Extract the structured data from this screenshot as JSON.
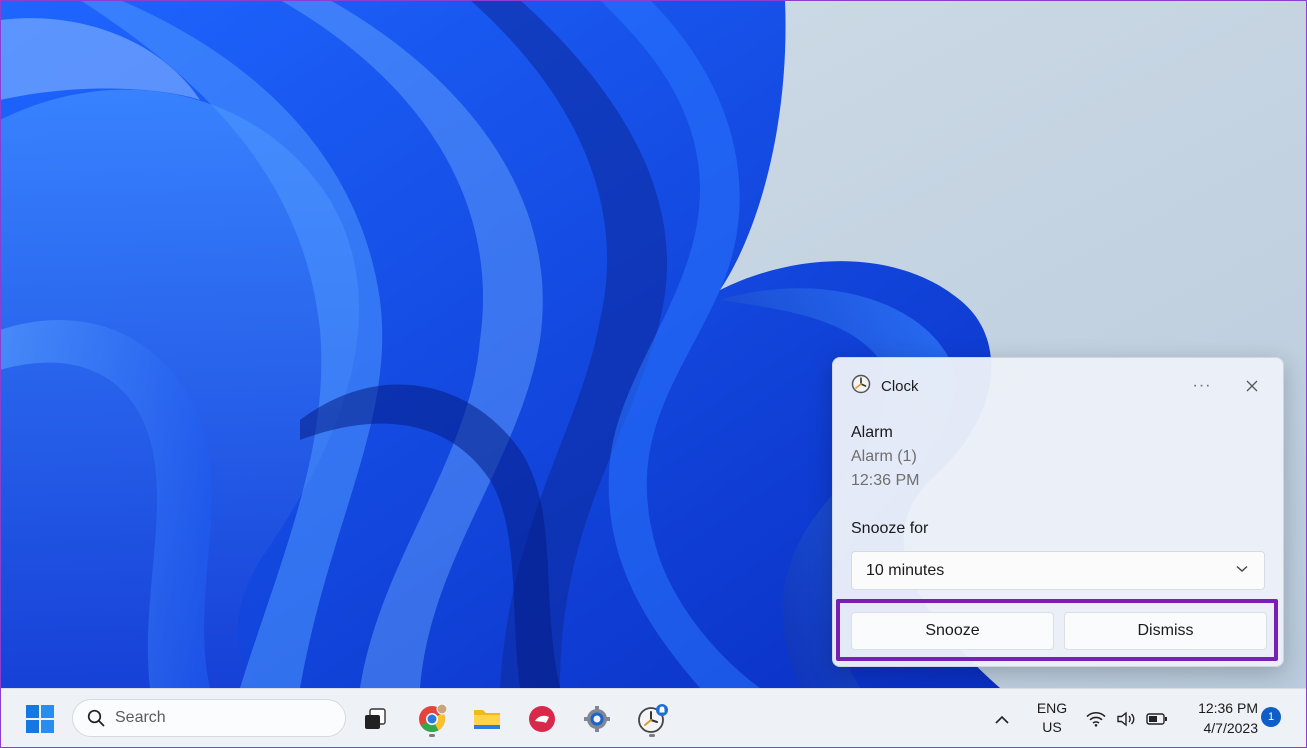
{
  "notification": {
    "app_name": "Clock",
    "more_icon": "more-dots-icon",
    "close_icon": "close-icon",
    "title": "Alarm",
    "alarm_name": "Alarm (1)",
    "time": "12:36 PM",
    "snooze_label": "Snooze for",
    "snooze_selected": "10 minutes",
    "snooze_button": "Snooze",
    "dismiss_button": "Dismiss",
    "highlight_color": "#7a1fb3"
  },
  "taskbar": {
    "search_placeholder": "Search",
    "language_line1": "ENG",
    "language_line2": "US",
    "time": "12:36 PM",
    "date": "4/7/2023",
    "notification_count": "1",
    "pinned_icons": [
      "windows-start-icon",
      "task-view-icon",
      "chrome-icon",
      "file-explorer-icon",
      "red-app-icon",
      "settings-gear-icon",
      "clock-app-icon"
    ],
    "tray_icons": [
      "chevron-up-icon",
      "wifi-icon",
      "volume-icon",
      "battery-icon"
    ]
  }
}
